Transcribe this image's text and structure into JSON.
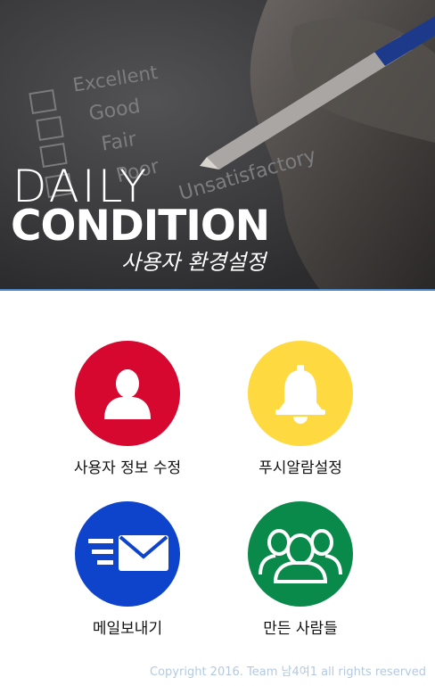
{
  "hero": {
    "survey_options": [
      "Excellent",
      "Good",
      "Fair",
      "Poor",
      "Unsatisfactory"
    ],
    "brand_line1": "DAILY",
    "brand_line2": "CONDITION",
    "subtitle": "사용자 환경설정"
  },
  "menu": [
    {
      "label": "사용자 정보 수정",
      "icon": "user-icon",
      "color": "#d6082f"
    },
    {
      "label": "푸시알람설정",
      "icon": "bell-icon",
      "color": "#fed940"
    },
    {
      "label": "메일보내기",
      "icon": "mail-icon",
      "color": "#0e43cc"
    },
    {
      "label": "만든 사람들",
      "icon": "people-icon",
      "color": "#0a8a4a"
    }
  ],
  "footer": {
    "copyright": "Copyright 2016. Team 남4여1 all rights reserved"
  },
  "colors": {
    "hero_accent_line": "#4f87c9",
    "copyright_text": "#b4c9e0"
  }
}
